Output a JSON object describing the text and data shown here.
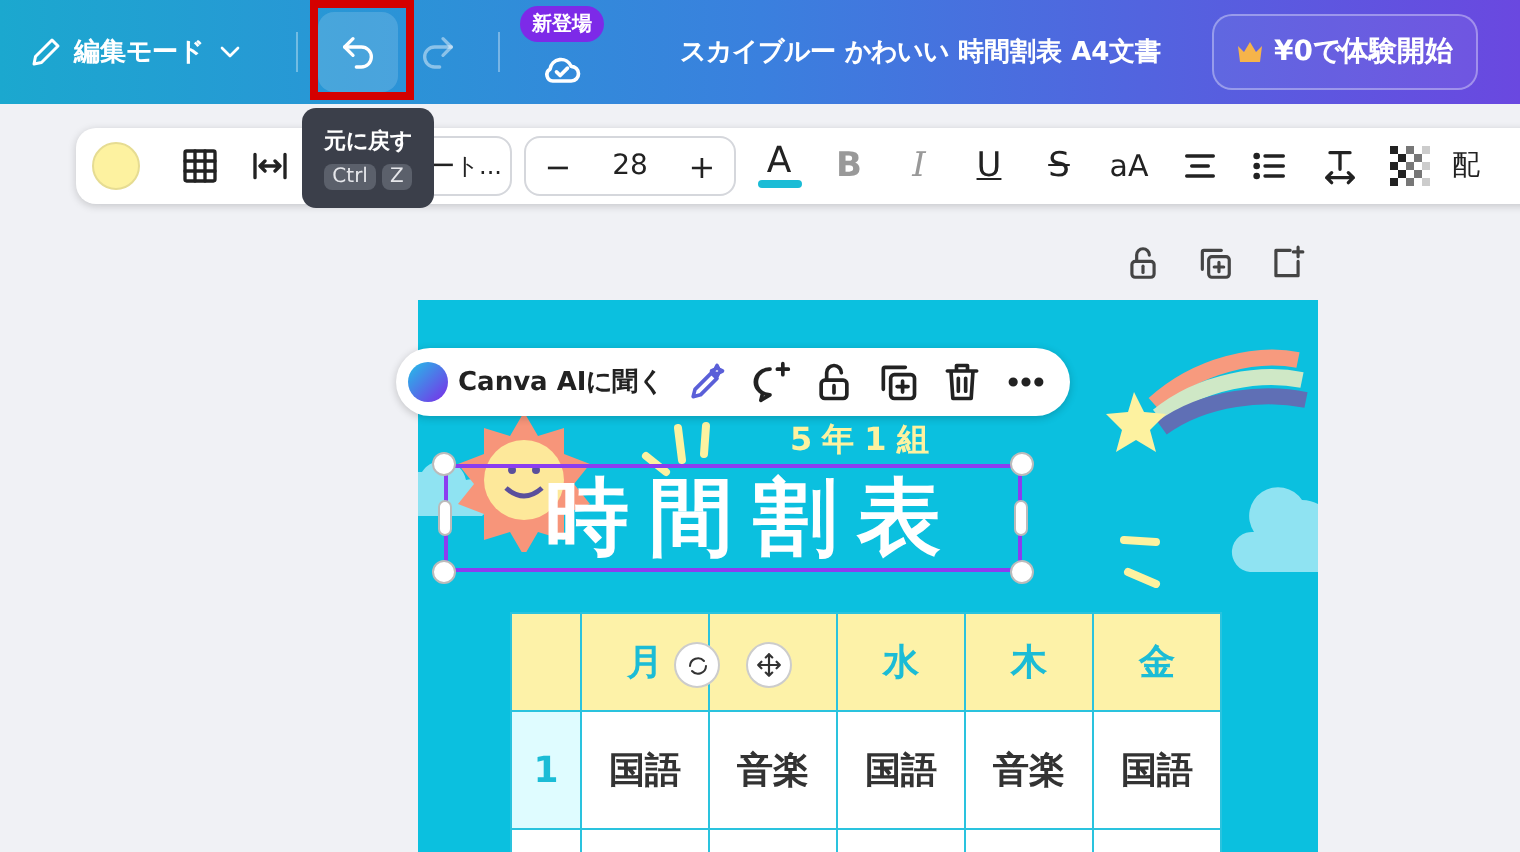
{
  "topbar": {
    "mode_menu": "編集モード",
    "undo": {
      "highlighted": true
    },
    "redo": {
      "disabled": true
    },
    "new_badge": "新登場",
    "title": "スカイブルー かわいい 時間割表 A4文書",
    "trial_button": "¥0で体験開始"
  },
  "tooltip": {
    "text": "元に戻す",
    "keys": [
      "Ctrl",
      "Z"
    ]
  },
  "toolbar": {
    "font": "ート...",
    "decrease": "−",
    "font_size": "28",
    "increase": "+",
    "tools": [
      {
        "kind": "text-color",
        "label": "A",
        "disabled": false
      },
      {
        "kind": "bold",
        "label": "B",
        "disabled": true
      },
      {
        "kind": "italic",
        "label": "I",
        "disabled": true
      },
      {
        "kind": "underline",
        "label": "U",
        "disabled": false
      },
      {
        "kind": "strike",
        "label": "S",
        "disabled": false
      },
      {
        "kind": "case",
        "label": "aA",
        "disabled": false
      },
      {
        "kind": "align",
        "disabled": false
      },
      {
        "kind": "list",
        "disabled": false
      },
      {
        "kind": "spacing",
        "disabled": false
      },
      {
        "kind": "transparency",
        "disabled": false
      }
    ],
    "more": "配"
  },
  "action_bar": {
    "ai_button": "Canva AIに聞く"
  },
  "page": {
    "class_label": "5年1組",
    "title": "時間割表",
    "table": {
      "header": [
        {
          "label": "月"
        },
        {
          "covered": true
        },
        {
          "label": "水"
        },
        {
          "label": "木"
        },
        {
          "label": "金"
        }
      ],
      "rows": [
        {
          "period": "1",
          "cells": [
            "国語",
            "音楽",
            "国語",
            "音楽",
            "国語"
          ]
        }
      ]
    }
  }
}
